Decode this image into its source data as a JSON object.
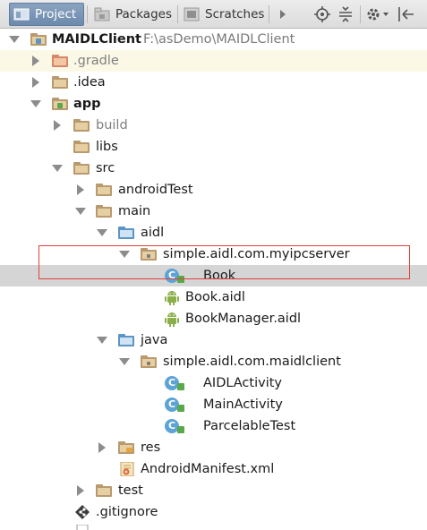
{
  "tabs": [
    {
      "label": "Project",
      "active": true,
      "icon": "project-icon"
    },
    {
      "label": "Packages",
      "active": false,
      "icon": "packages-icon"
    },
    {
      "label": "Scratches",
      "active": false,
      "icon": "scratches-icon"
    }
  ],
  "toolbar": {
    "icons": [
      "overflow-arrow-icon",
      "locate-target-icon",
      "collapse-all-icon",
      "settings-icon",
      "hide-panel-icon"
    ]
  },
  "tree": {
    "root": {
      "label": "MAIDLClient",
      "path": "F:\\asDemo\\MAIDLClient"
    },
    "gradle": ".gradle",
    "idea": ".idea",
    "app": "app",
    "build": "build",
    "libs": "libs",
    "src": "src",
    "androidTest": "androidTest",
    "main": "main",
    "aidl": "aidl",
    "aidl_pkg": "simple.aidl.com.myipcserver",
    "book": "Book",
    "book_aidl": "Book.aidl",
    "bookmanager_aidl": "BookManager.aidl",
    "java": "java",
    "java_pkg": "simple.aidl.com.maidlclient",
    "aidl_activity": "AIDLActivity",
    "main_activity": "MainActivity",
    "parcelable_test": "ParcelableTest",
    "res": "res",
    "manifest": "AndroidManifest.xml",
    "test": "test",
    "gitignore": ".gitignore",
    "class_badge": "C"
  },
  "colors": {
    "selection": "#d5d5d5",
    "highlight_row": "#fbf8e6",
    "annotation_box": "#e0413a",
    "active_tab": "#7591b3"
  }
}
